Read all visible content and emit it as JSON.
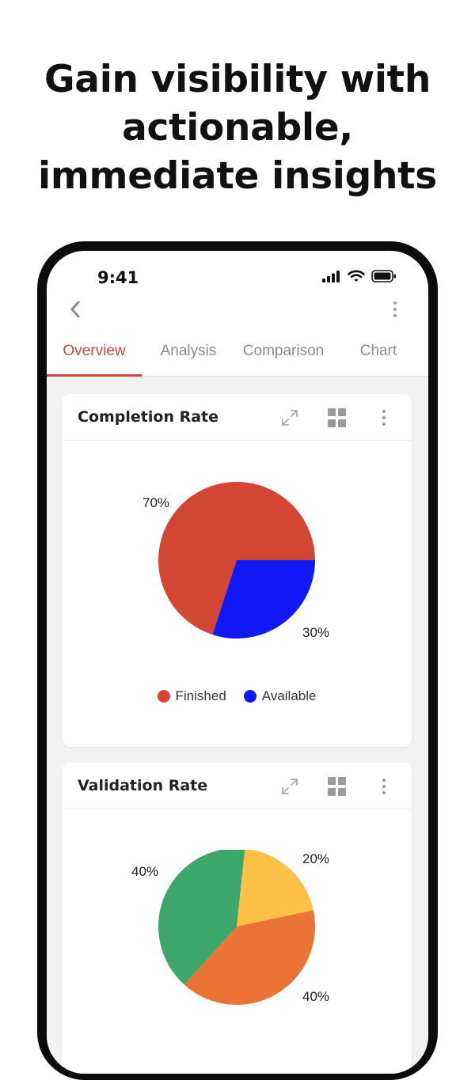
{
  "headline": [
    "Gain visibility with",
    "actionable,",
    "immediate insights"
  ],
  "status_bar": {
    "time": "9:41"
  },
  "tabs": [
    {
      "label": "Overview",
      "active": true
    },
    {
      "label": "Analysis",
      "active": false
    },
    {
      "label": "Comparison",
      "active": false
    },
    {
      "label": "Chart",
      "active": false
    }
  ],
  "cards": [
    {
      "title": "Completion Rate",
      "labels": {
        "top_left": "70%",
        "bottom_right": "30%"
      },
      "legend": [
        {
          "label": "Finished",
          "color": "#d34634"
        },
        {
          "label": "Available",
          "color": "#1019f5"
        }
      ]
    },
    {
      "title": "Validation Rate",
      "labels": {
        "top_left": "40%",
        "top_right": "20%",
        "bottom_right": "40%"
      }
    }
  ],
  "chart_data": [
    {
      "type": "pie",
      "title": "Completion Rate",
      "categories": [
        "Finished",
        "Available"
      ],
      "values": [
        70,
        30
      ],
      "colors": [
        "#d34634",
        "#1019f5"
      ],
      "legend": "bottom"
    },
    {
      "type": "pie",
      "title": "Validation Rate",
      "values": [
        20,
        40,
        40
      ],
      "colors": [
        "#ffc145",
        "#ec7336",
        "#3da76b"
      ]
    }
  ]
}
